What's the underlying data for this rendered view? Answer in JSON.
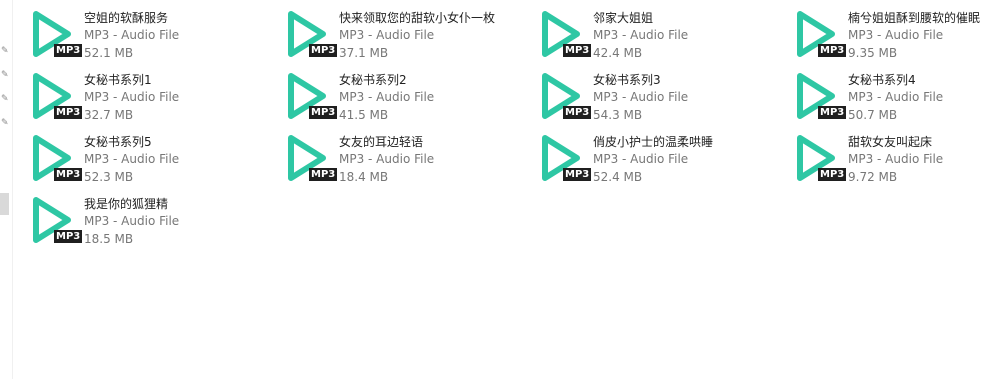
{
  "colors": {
    "play_icon": "#2ec7a4",
    "badge_bg": "#1f1f1f",
    "badge_text": "#ffffff",
    "name_text": "#222222",
    "meta_text": "#777777"
  },
  "icons": {
    "file": "mp3-play-icon",
    "pin": "pin-icon"
  },
  "files": [
    {
      "name": "空姐的软酥服务",
      "type": "MP3 - Audio File",
      "size": "52.1 MB",
      "badge": "MP3"
    },
    {
      "name": "快来领取您的甜软小女仆一枚",
      "type": "MP3 - Audio File",
      "size": "37.1 MB",
      "badge": "MP3"
    },
    {
      "name": "邻家大姐姐",
      "type": "MP3 - Audio File",
      "size": "42.4 MB",
      "badge": "MP3"
    },
    {
      "name": "楠兮姐姐酥到腰软的催眠",
      "type": "MP3 - Audio File",
      "size": "9.35 MB",
      "badge": "MP3"
    },
    {
      "name": "女秘书系列1",
      "type": "MP3 - Audio File",
      "size": "32.7 MB",
      "badge": "MP3"
    },
    {
      "name": "女秘书系列2",
      "type": "MP3 - Audio File",
      "size": "41.5 MB",
      "badge": "MP3"
    },
    {
      "name": "女秘书系列3",
      "type": "MP3 - Audio File",
      "size": "54.3 MB",
      "badge": "MP3"
    },
    {
      "name": "女秘书系列4",
      "type": "MP3 - Audio File",
      "size": "50.7 MB",
      "badge": "MP3"
    },
    {
      "name": "女秘书系列5",
      "type": "MP3 - Audio File",
      "size": "52.3 MB",
      "badge": "MP3"
    },
    {
      "name": "女友的耳边轻语",
      "type": "MP3 - Audio File",
      "size": "18.4 MB",
      "badge": "MP3"
    },
    {
      "name": "俏皮小护士的温柔哄睡",
      "type": "MP3 - Audio File",
      "size": "52.4 MB",
      "badge": "MP3"
    },
    {
      "name": "甜软女友叫起床",
      "type": "MP3 - Audio File",
      "size": "9.72 MB",
      "badge": "MP3"
    },
    {
      "name": "我是你的狐狸精",
      "type": "MP3 - Audio File",
      "size": "18.5 MB",
      "badge": "MP3"
    }
  ]
}
